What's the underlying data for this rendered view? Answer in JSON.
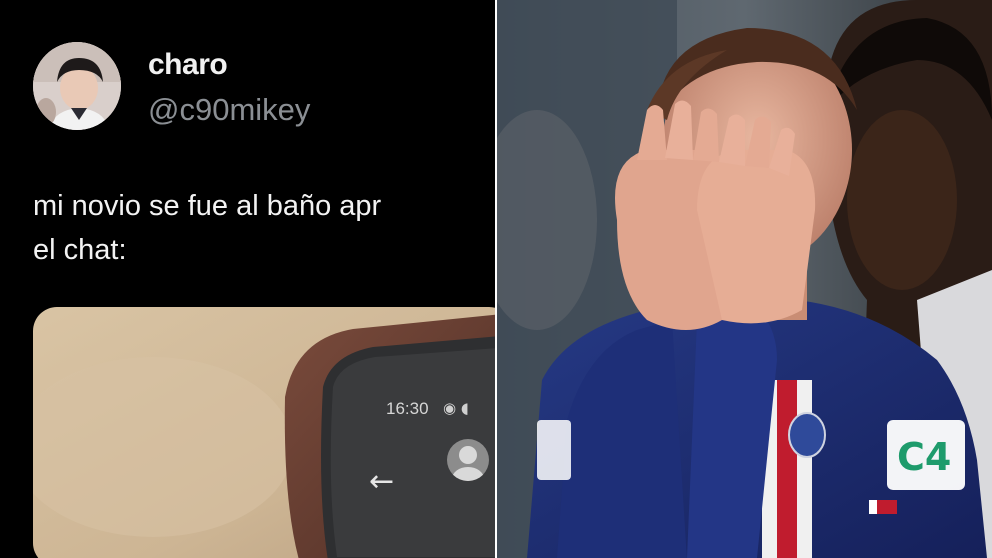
{
  "tweet": {
    "display_name": "charo",
    "handle": "@c90mikey",
    "text_lines": [
      "mi novio se fue al baño apr",
      "el chat:"
    ]
  },
  "phone": {
    "time": "16:30",
    "back_icon": "arrow-left-icon"
  },
  "photo": {
    "badge_text": "C4"
  },
  "colors": {
    "tweet_background": "#000000",
    "name_color": "#f1f1f1",
    "handle_color": "#8b8f94",
    "jersey_navy": "#1c2a6b"
  }
}
